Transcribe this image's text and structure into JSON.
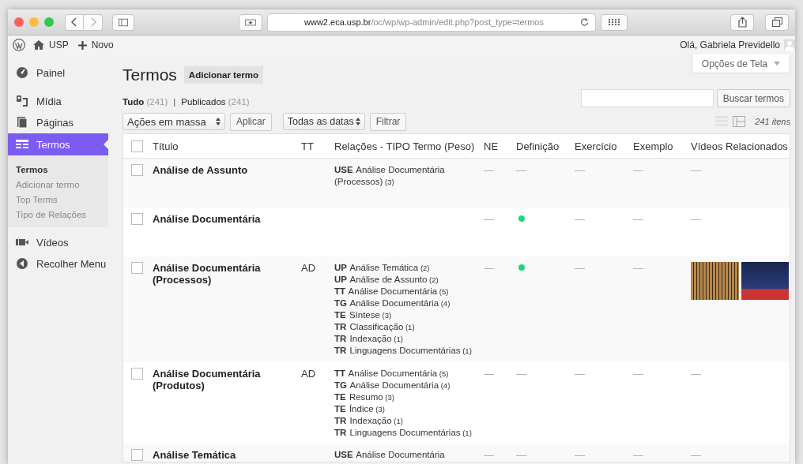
{
  "browser": {
    "url_host": "www2.eca.usp.br",
    "url_path": "/oc/wp/wp-admin/edit.php?post_type=termos"
  },
  "admin_bar": {
    "site": "USP",
    "new": "Novo",
    "greeting": "Olá, Gabriela Previdello"
  },
  "sidebar": {
    "items": [
      {
        "label": "Painel",
        "selected": false
      },
      {
        "label": "Mídia",
        "selected": false
      },
      {
        "label": "Páginas",
        "selected": false
      },
      {
        "label": "Termos",
        "selected": true,
        "children": [
          {
            "label": "Termos",
            "selected": true
          },
          {
            "label": "Adicionar termo",
            "selected": false
          },
          {
            "label": "Top Terms",
            "selected": false
          },
          {
            "label": "Tipo de Relações",
            "selected": false
          }
        ]
      },
      {
        "label": "Vídeos",
        "selected": false
      },
      {
        "label": "Recolher Menu",
        "selected": false
      }
    ]
  },
  "page": {
    "title": "Termos",
    "add_button": "Adicionar termo",
    "screen_options": "Opções de Tela",
    "filters": [
      {
        "label": "Tudo",
        "count": "(241)",
        "selected": true
      },
      {
        "label": "Publicados",
        "count": "(241)",
        "selected": false
      }
    ],
    "filter_separator": "|",
    "search_button": "Buscar termos",
    "bulk_actions": "Ações em massa",
    "apply": "Aplicar",
    "dates": "Todas as datas",
    "filter_button": "Filtrar",
    "item_count": "241 itens"
  },
  "table": {
    "select_all_checked": false,
    "columns": [
      "Título",
      "TT",
      "Relações - TIPO Termo (Peso)",
      "NE",
      "Definição",
      "Exercício",
      "Exemplo",
      "Vídeos Relacionados"
    ],
    "rows": [
      {
        "checked": false,
        "cells": [
          {
            "kind": "title",
            "text": "Análise de Assunto"
          },
          {
            "kind": "text",
            "text": ""
          },
          {
            "kind": "relations",
            "relations": [
              {
                "type": "USE",
                "term": "Análise Documentária (Processos)",
                "weight": "(3)"
              }
            ]
          },
          {
            "kind": "text",
            "text": "—"
          },
          {
            "kind": "text",
            "text": "—"
          },
          {
            "kind": "text",
            "text": "—"
          },
          {
            "kind": "text",
            "text": "—"
          },
          {
            "kind": "text",
            "text": "—"
          }
        ]
      },
      {
        "checked": false,
        "cells": [
          {
            "kind": "title",
            "text": "Análise Documentária"
          },
          {
            "kind": "text",
            "text": ""
          },
          {
            "kind": "text",
            "text": ""
          },
          {
            "kind": "text",
            "text": "—"
          },
          {
            "kind": "dot",
            "color": "#1fd67a"
          },
          {
            "kind": "text",
            "text": "—"
          },
          {
            "kind": "text",
            "text": "—"
          },
          {
            "kind": "text",
            "text": "—"
          }
        ]
      },
      {
        "checked": false,
        "cells": [
          {
            "kind": "title",
            "text": "Análise Documentária (Processos)"
          },
          {
            "kind": "text",
            "text": "AD"
          },
          {
            "kind": "relations",
            "relations": [
              {
                "type": "UP",
                "term": "Análise Temática",
                "weight": "(2)"
              },
              {
                "type": "UP",
                "term": "Análise de Assunto",
                "weight": "(2)"
              },
              {
                "type": "TT",
                "term": "Análise Documentária",
                "weight": "(5)"
              },
              {
                "type": "TG",
                "term": "Análise Documentária",
                "weight": "(4)"
              },
              {
                "type": "TE",
                "term": "Síntese",
                "weight": "(3)"
              },
              {
                "type": "TR",
                "term": "Classificação",
                "weight": "(1)"
              },
              {
                "type": "TR",
                "term": "Indexação",
                "weight": "(1)"
              },
              {
                "type": "TR",
                "term": "Linguagens Documentárias",
                "weight": "(1)"
              }
            ]
          },
          {
            "kind": "text",
            "text": "—"
          },
          {
            "kind": "dot",
            "color": "#1fd67a"
          },
          {
            "kind": "text",
            "text": "—"
          },
          {
            "kind": "text",
            "text": "—"
          },
          {
            "kind": "thumbs",
            "thumbs": [
              {
                "kind": "board"
              },
              {
                "kind": "stage"
              }
            ]
          }
        ]
      },
      {
        "checked": false,
        "cells": [
          {
            "kind": "title",
            "text": "Análise Documentária (Produtos)"
          },
          {
            "kind": "text",
            "text": "AD"
          },
          {
            "kind": "relations",
            "relations": [
              {
                "type": "TT",
                "term": "Análise Documentária",
                "weight": "(5)"
              },
              {
                "type": "TG",
                "term": "Análise Documentária",
                "weight": "(4)"
              },
              {
                "type": "TE",
                "term": "Resumo",
                "weight": "(3)"
              },
              {
                "type": "TE",
                "term": "Índice",
                "weight": "(3)"
              },
              {
                "type": "TR",
                "term": "Indexação",
                "weight": "(1)"
              },
              {
                "type": "TR",
                "term": "Linguagens Documentárias",
                "weight": "(1)"
              }
            ]
          },
          {
            "kind": "text",
            "text": "—"
          },
          {
            "kind": "text",
            "text": "—"
          },
          {
            "kind": "text",
            "text": "—"
          },
          {
            "kind": "text",
            "text": "—"
          },
          {
            "kind": "text",
            "text": "—"
          }
        ]
      },
      {
        "checked": false,
        "cells": [
          {
            "kind": "title",
            "text": "Análise Temática"
          },
          {
            "kind": "text",
            "text": ""
          },
          {
            "kind": "relations",
            "relations": [
              {
                "type": "USE",
                "term": "Análise Documentária"
              }
            ]
          },
          {
            "kind": "text",
            "text": "—"
          },
          {
            "kind": "text",
            "text": "—"
          },
          {
            "kind": "text",
            "text": "—"
          },
          {
            "kind": "text",
            "text": "—"
          },
          {
            "kind": "text",
            "text": "—"
          }
        ]
      }
    ]
  }
}
